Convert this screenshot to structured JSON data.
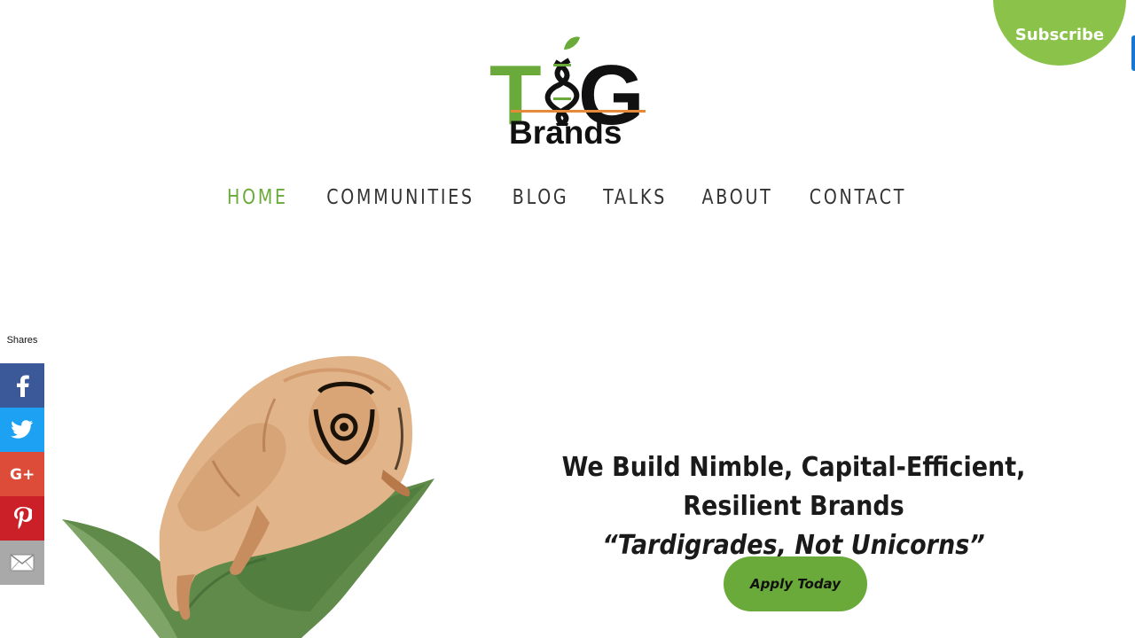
{
  "logo": {
    "t": "T",
    "g": "G",
    "brands": "Brands"
  },
  "subscribe": {
    "label": "Subscribe"
  },
  "nav": {
    "items": [
      {
        "label": "HOME",
        "active": true
      },
      {
        "label": "COMMUNITIES"
      },
      {
        "label": "BLOG"
      },
      {
        "label": "TALKS"
      },
      {
        "label": "ABOUT"
      },
      {
        "label": "CONTACT"
      }
    ]
  },
  "share": {
    "label": "Shares",
    "buttons": [
      {
        "icon": "facebook-icon",
        "color": "#3b5998"
      },
      {
        "icon": "twitter-icon",
        "color": "#1da1f2"
      },
      {
        "icon": "google-plus-icon",
        "color": "#dd4b39"
      },
      {
        "icon": "pinterest-icon",
        "color": "#cb2027"
      },
      {
        "icon": "email-icon",
        "color": "#a9a9a9"
      }
    ]
  },
  "hero": {
    "headline": "We Build Nimble, Capital-Efficient, Resilient Brands",
    "tagline": "“Tardigrades, Not Unicorns”",
    "cta": "Apply Today"
  },
  "colors": {
    "accent": "#6aaa3a",
    "subscribe": "#8bc34a",
    "text": "#1a1a1a"
  }
}
